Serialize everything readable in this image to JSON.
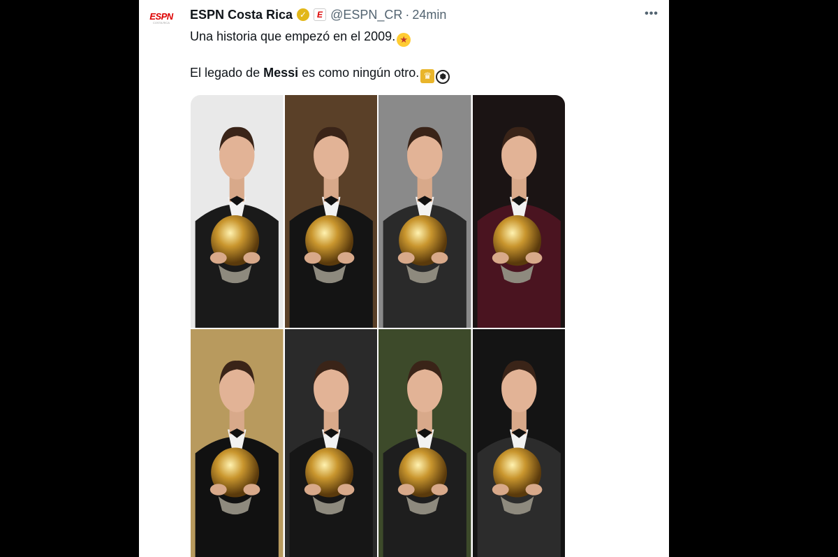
{
  "tweet": {
    "display_name": "ESPN Costa Rica",
    "handle": "@ESPN_CR",
    "separator": "·",
    "time": "24min",
    "line1_text": "Una historia que empezó en el 2009.",
    "line2_prefix": "El legado de ",
    "line2_bold": "Messi",
    "line2_suffix": " es como ningún otro.",
    "more_label": "•••"
  },
  "avatar": {
    "logo_text": "ESPN",
    "sub_text": "COSTA RICA"
  },
  "affiliate_badge": "E",
  "icons": {
    "verified": "verified-badge-icon",
    "emoji1": "star-struck-emoji-icon",
    "emoji2": "trophy-emoji-icon",
    "emoji3": "soccer-ball-emoji-icon"
  },
  "colors": {
    "verified": "#e2b719",
    "espn_red": "#dd0000",
    "muted": "#536471",
    "text": "#0f1419"
  },
  "photos": [
    {
      "bg": "#e9e9e9",
      "suit": "#1a1a1a"
    },
    {
      "bg": "#5a4028",
      "suit": "#141414"
    },
    {
      "bg": "#8a8a8a",
      "suit": "#2a2a2a"
    },
    {
      "bg": "#1b1414",
      "suit": "#4a1420"
    },
    {
      "bg": "#b89a5e",
      "suit": "#111111"
    },
    {
      "bg": "#2a2a2a",
      "suit": "#161616"
    },
    {
      "bg": "#3d4a2a",
      "suit": "#1e1e1e"
    },
    {
      "bg": "#141414",
      "suit": "#2c2c2c"
    }
  ]
}
